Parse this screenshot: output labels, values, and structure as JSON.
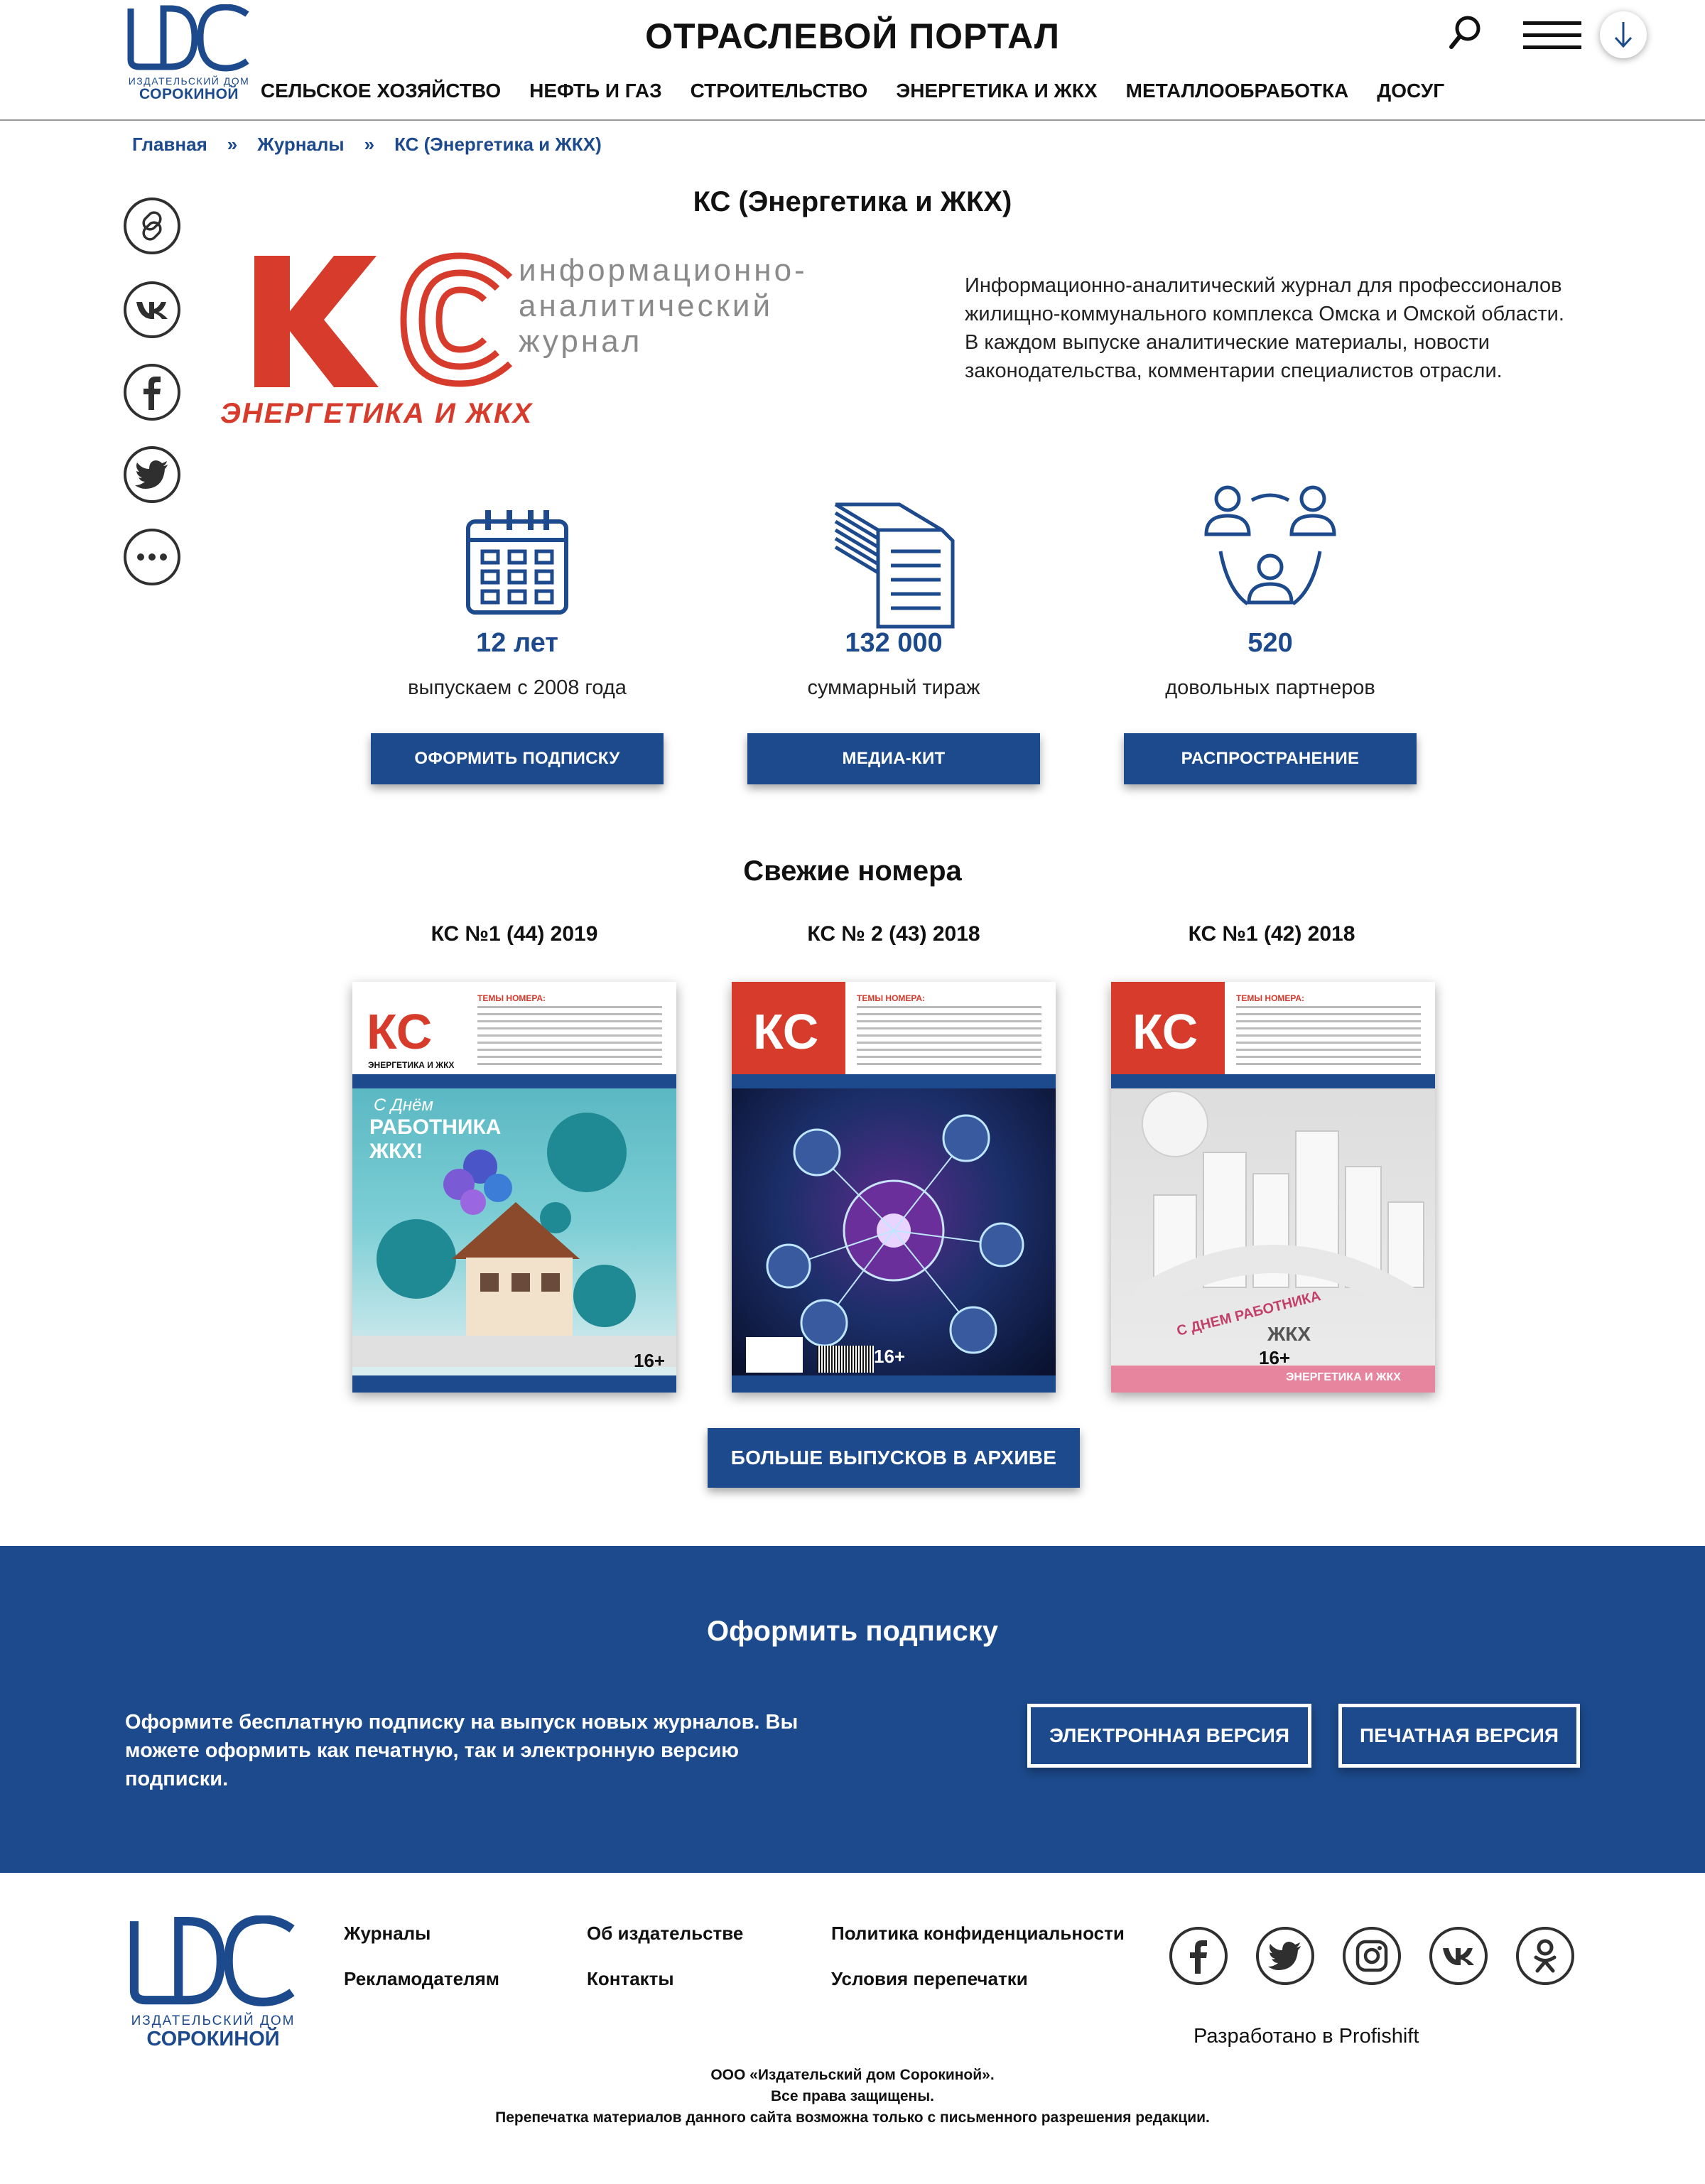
{
  "header": {
    "logo_sub1": "ИЗДАТЕЛЬСКИЙ ДОМ",
    "logo_sub2": "СОРОКИНОЙ",
    "title": "ОТРАСЛЕВОЙ ПОРТАЛ",
    "nav": [
      "СЕЛЬСКОЕ ХОЗЯЙСТВО",
      "НЕФТЬ И ГАЗ",
      "СТРОИТЕЛЬСТВО",
      "ЭНЕРГЕТИКА И ЖКХ",
      "МЕТАЛЛООБРАБОТКА",
      "ДОСУГ"
    ]
  },
  "breadcrumb": {
    "items": [
      "Главная",
      "Журналы",
      "КС (Энергетика и ЖКХ)"
    ],
    "separator": "»"
  },
  "social_side": [
    "link-icon",
    "vk-icon",
    "facebook-icon",
    "twitter-icon",
    "more-icon"
  ],
  "journal": {
    "title": "КС (Энергетика и ЖКХ)",
    "logo_text_1": "информационно-",
    "logo_text_2": "аналитический",
    "logo_text_3": "журнал",
    "logo_subtitle": "ЭНЕРГЕТИКА И ЖКХ",
    "description": "Информационно-аналитический журнал для профессионалов жилищно-коммунального комплекса Омска и Омской области. В каждом выпуске аналитические материалы, новости законодательства, комментарии специалистов отрасли."
  },
  "stats": [
    {
      "icon": "calendar-icon",
      "value": "12 лет",
      "label": "выпускаем с 2008 года",
      "button": "ОФОРМИТЬ ПОДПИСКУ"
    },
    {
      "icon": "documents-icon",
      "value": "132 000",
      "label": "суммарный тираж",
      "button": "МЕДИА-КИТ"
    },
    {
      "icon": "partners-icon",
      "value": "520",
      "label": "довольных партнеров",
      "button": "РАСПРОСТРАНЕНИЕ"
    }
  ],
  "issues": {
    "section_title": "Свежие номера",
    "items": [
      {
        "title": "КС №1 (44) 2019",
        "cover_line1": "С Днём",
        "cover_line2": "РАБОТНИКА",
        "cover_line3": "ЖКХ!"
      },
      {
        "title": "КС № 2 (43) 2018"
      },
      {
        "title": "КС №1 (42) 2018",
        "cover_line1": "С ДНЕМ РАБОТНИКА",
        "cover_line2": "ЖКХ",
        "cover_line3": "ЭНЕРГЕТИКА И ЖКХ"
      }
    ],
    "cover_brand": "ЭНЕРГЕТИКА И ЖКХ",
    "cover_topics": "ТЕМЫ НОМЕРА:",
    "age": "16+",
    "archive_button": "БОЛЬШЕ ВЫПУСКОВ В АРХИВЕ"
  },
  "subscribe": {
    "title": "Оформить подписку",
    "text": "Оформите бесплатную подписку на выпуск новых журналов. Вы можете оформить как печатную, так и электронную версию подписки.",
    "btn_electronic": "ЭЛЕКТРОННАЯ ВЕРСИЯ",
    "btn_print": "ПЕЧАТНАЯ ВЕРСИЯ"
  },
  "footer": {
    "links_col1": [
      "Журналы",
      "Рекламодателям"
    ],
    "links_col2": [
      "Об издательстве",
      "Контакты"
    ],
    "links_col3": [
      "Политика конфиденциальности",
      "Условия перепечатки"
    ],
    "social": [
      "facebook-icon",
      "twitter-icon",
      "instagram-icon",
      "vk-icon",
      "odnoklassniki-icon"
    ],
    "developed": "Разработано в Profishift",
    "legal_1": "ООО «Издательский дом Сорокиной».",
    "legal_2": "Все права защищены.",
    "legal_3": "Перепечатка материалов данного сайта возможна только с письменного разрешения редакции."
  },
  "colors": {
    "brand_blue": "#1c4a8c",
    "logo_red": "#d63b2b"
  }
}
